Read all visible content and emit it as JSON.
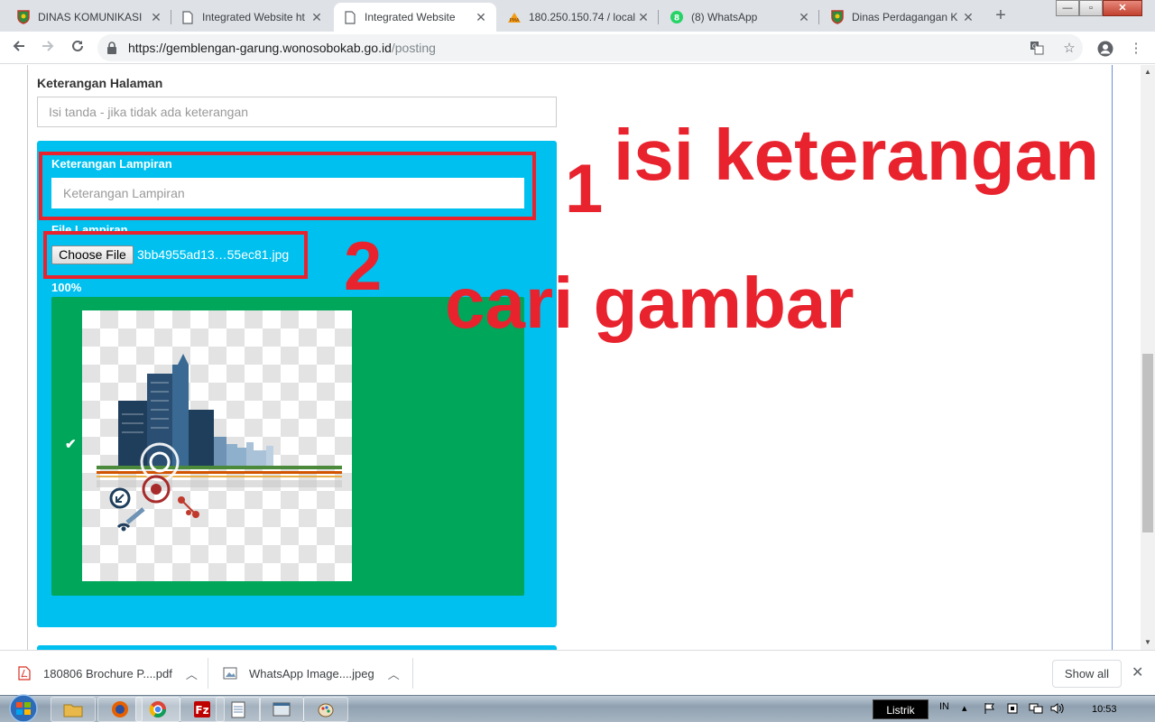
{
  "browser": {
    "tabs": [
      {
        "title": "DINAS KOMUNIKASI",
        "favicon": "shield-favicon",
        "active": false
      },
      {
        "title": "Integrated Website ht",
        "favicon": "page-favicon",
        "active": false
      },
      {
        "title": "Integrated Website",
        "favicon": "page-favicon",
        "active": true
      },
      {
        "title": "180.250.150.74 / local",
        "favicon": "pma-favicon",
        "active": false
      },
      {
        "title": "(8) WhatsApp",
        "favicon": "whatsapp-favicon",
        "active": false
      },
      {
        "title": "Dinas Perdagangan K",
        "favicon": "shield-favicon",
        "active": false
      }
    ],
    "url_host": "https://gemblengan-garung.wonosobokab.go.id",
    "url_path": "/posting",
    "window_buttons": {
      "minimize": "—",
      "maximize": "▫",
      "close": "✕"
    }
  },
  "form": {
    "keterangan_halaman_label": "Keterangan Halaman",
    "keterangan_halaman_placeholder": "Isi tanda - jika tidak ada keterangan",
    "keterangan_lampiran_label": "Keterangan Lampiran",
    "keterangan_lampiran_placeholder": "Keterangan Lampiran",
    "file_lampiran_label": "File Lampiran",
    "choose_file_label": "Choose File",
    "file_name": "3bb4955ad13…55ec81.jpg",
    "upload_percent": "100%",
    "check_mark": "✔"
  },
  "annotations": {
    "step1_number": "1",
    "step1_text": "isi keterangan",
    "step2_number": "2",
    "step2_text": "cari gambar",
    "color": "#e8232e"
  },
  "downloads": {
    "items": [
      {
        "name": "180806 Brochure P....pdf",
        "icon": "pdf-icon"
      },
      {
        "name": "WhatsApp Image....jpeg",
        "icon": "image-file-icon"
      }
    ],
    "show_all_label": "Show all",
    "close_label": "✕"
  },
  "taskbar": {
    "listrik_label": "Listrik",
    "language": "IN",
    "clock": "10:53"
  },
  "colors": {
    "panel_blue": "#00c0ef",
    "upload_green": "#00a65a",
    "annotation_red": "#e8232e"
  }
}
